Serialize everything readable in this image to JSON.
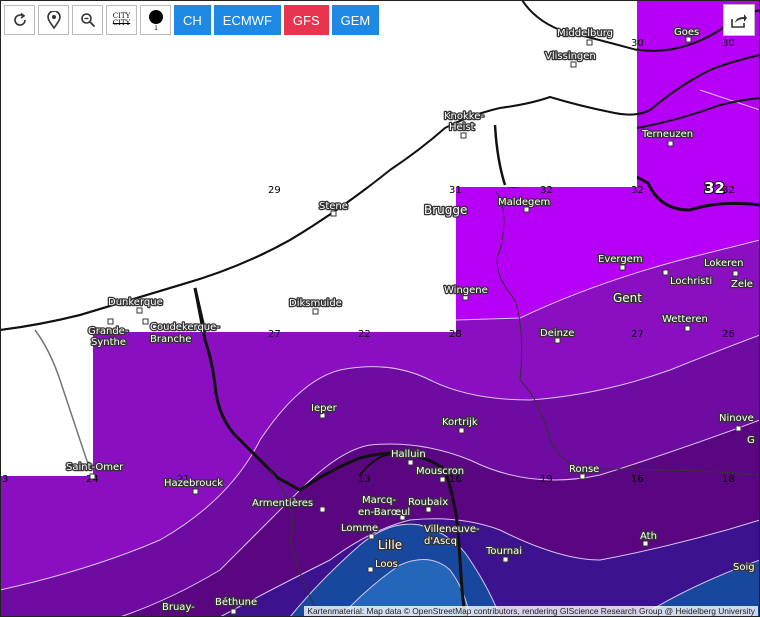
{
  "toolbar": {
    "city_icon_line1": "CITY",
    "city_icon_line2": "CITY",
    "dot_icon_label": "1",
    "models": [
      {
        "label": "CH",
        "color": "#1e88e5"
      },
      {
        "label": "ECMWF",
        "color": "#1e88e5"
      },
      {
        "label": "GFS",
        "color": "#e8344e"
      },
      {
        "label": "GEM",
        "color": "#1e88e5"
      }
    ],
    "icons": [
      "refresh-icon",
      "location-pin-icon",
      "zoom-out-icon",
      "city-labels-icon",
      "dot-size-icon"
    ]
  },
  "share_icon": "share-icon",
  "cities": {
    "middelburg": "Middelburg",
    "vlissingen": "Vlissingen",
    "goes": "Goes",
    "knokke": "Knokke-",
    "heist": "Heist",
    "terneuzen": "Terneuzen",
    "brugge": "Brugge",
    "maldegem": "Maldegem",
    "stene": "Stene",
    "evergem": "Evergem",
    "lokeren": "Lokeren",
    "lochristi": "Lochristi",
    "zele": "Zele",
    "gent": "Gent",
    "wingene": "Wingene",
    "dunkerque": "Dunkerque",
    "grande_1": "Grande-",
    "grande_2": "Synthe",
    "coudekerque_1": "Coudekerque-",
    "coudekerque_2": "Branche",
    "diksmuide": "Diksmuide",
    "deinze": "Deinze",
    "wetteren": "Wetteren",
    "ieper": "Ieper",
    "kortrijk": "Kortrijk",
    "ninove": "Ninove",
    "halluin": "Halluin",
    "mouscron": "Mouscron",
    "ronse": "Ronse",
    "saint_omer": "Saint-Omer",
    "hazebrouck": "Hazebrouck",
    "armentieres": "Armentières",
    "marcq_1": "Marcq-",
    "marcq_2": "en-Barœul",
    "roubaix": "Roubaix",
    "lomme": "Lomme",
    "villeneuve_1": "Villeneuve-",
    "villeneuve_2": "d'Ascq",
    "lille": "Lille",
    "tournai": "Tournai",
    "ath": "Ath",
    "loos": "Loos",
    "bruay": "Bruay-",
    "bethune": "Béthune",
    "soig": "Soig",
    "g_edge": "G"
  },
  "isolines": {
    "v30a": "30",
    "v30b": "30",
    "v29": "29",
    "v31": "31",
    "v32a": "32",
    "v32b": "32",
    "v32big": "32",
    "v32e": "32",
    "v27a": "27",
    "v22": "22",
    "v28": "28",
    "v27b": "27",
    "v26": "26",
    "v24": "24",
    "v21": "21",
    "v13": "13",
    "v16a": "16",
    "v19": "19",
    "v16b": "16",
    "v3": "3",
    "v18": "18"
  },
  "colors": {
    "band_bright": "#b500f5",
    "band_purple": "#8a0fc0",
    "band_mid": "#6e0ba1",
    "band_deep": "#5a0680",
    "band_indigo": "#3c128f",
    "band_blue": "#17489e",
    "band_lightblue": "#2467b8"
  },
  "attribution": "Kartenmaterial: Map data © OpenStreetMap contributors, rendering GIScience Research Group @ Heidelberg University"
}
